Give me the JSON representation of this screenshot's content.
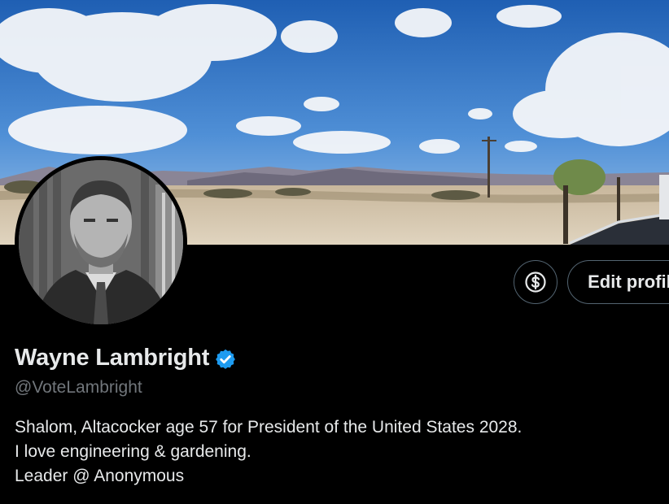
{
  "header": {
    "banner": "banner-image",
    "avatar": "avatar-image"
  },
  "actions": {
    "tip_icon": "dollar-icon",
    "edit_label": "Edit profile"
  },
  "profile": {
    "display_name": "Wayne Lambright",
    "verified_icon": "verified-badge-icon",
    "handle": "@VoteLambright",
    "bio_lines": [
      "Shalom, Altacocker age 57 for President of the United States 2028.",
      "I love engineering & gardening.",
      "Leader @ Anonymous"
    ]
  },
  "colors": {
    "background": "#000000",
    "text_primary": "#e7e9ea",
    "text_secondary": "#71767b",
    "verified_blue": "#1d9bf0",
    "button_border": "#536471"
  }
}
